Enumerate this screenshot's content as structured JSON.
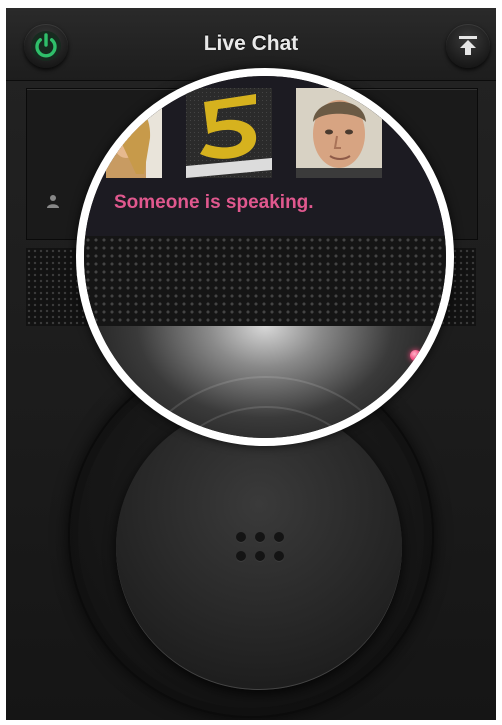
{
  "header": {
    "title": "Live Chat",
    "power_icon": "power-icon",
    "upload_icon": "upload-icon"
  },
  "chat": {
    "status_text": "Someone is speaking."
  },
  "colors": {
    "power_green": "#2fbf6a",
    "status_pink": "#e0588e",
    "indicator_pink": "#f0457a",
    "background": "#1b1b1b"
  }
}
